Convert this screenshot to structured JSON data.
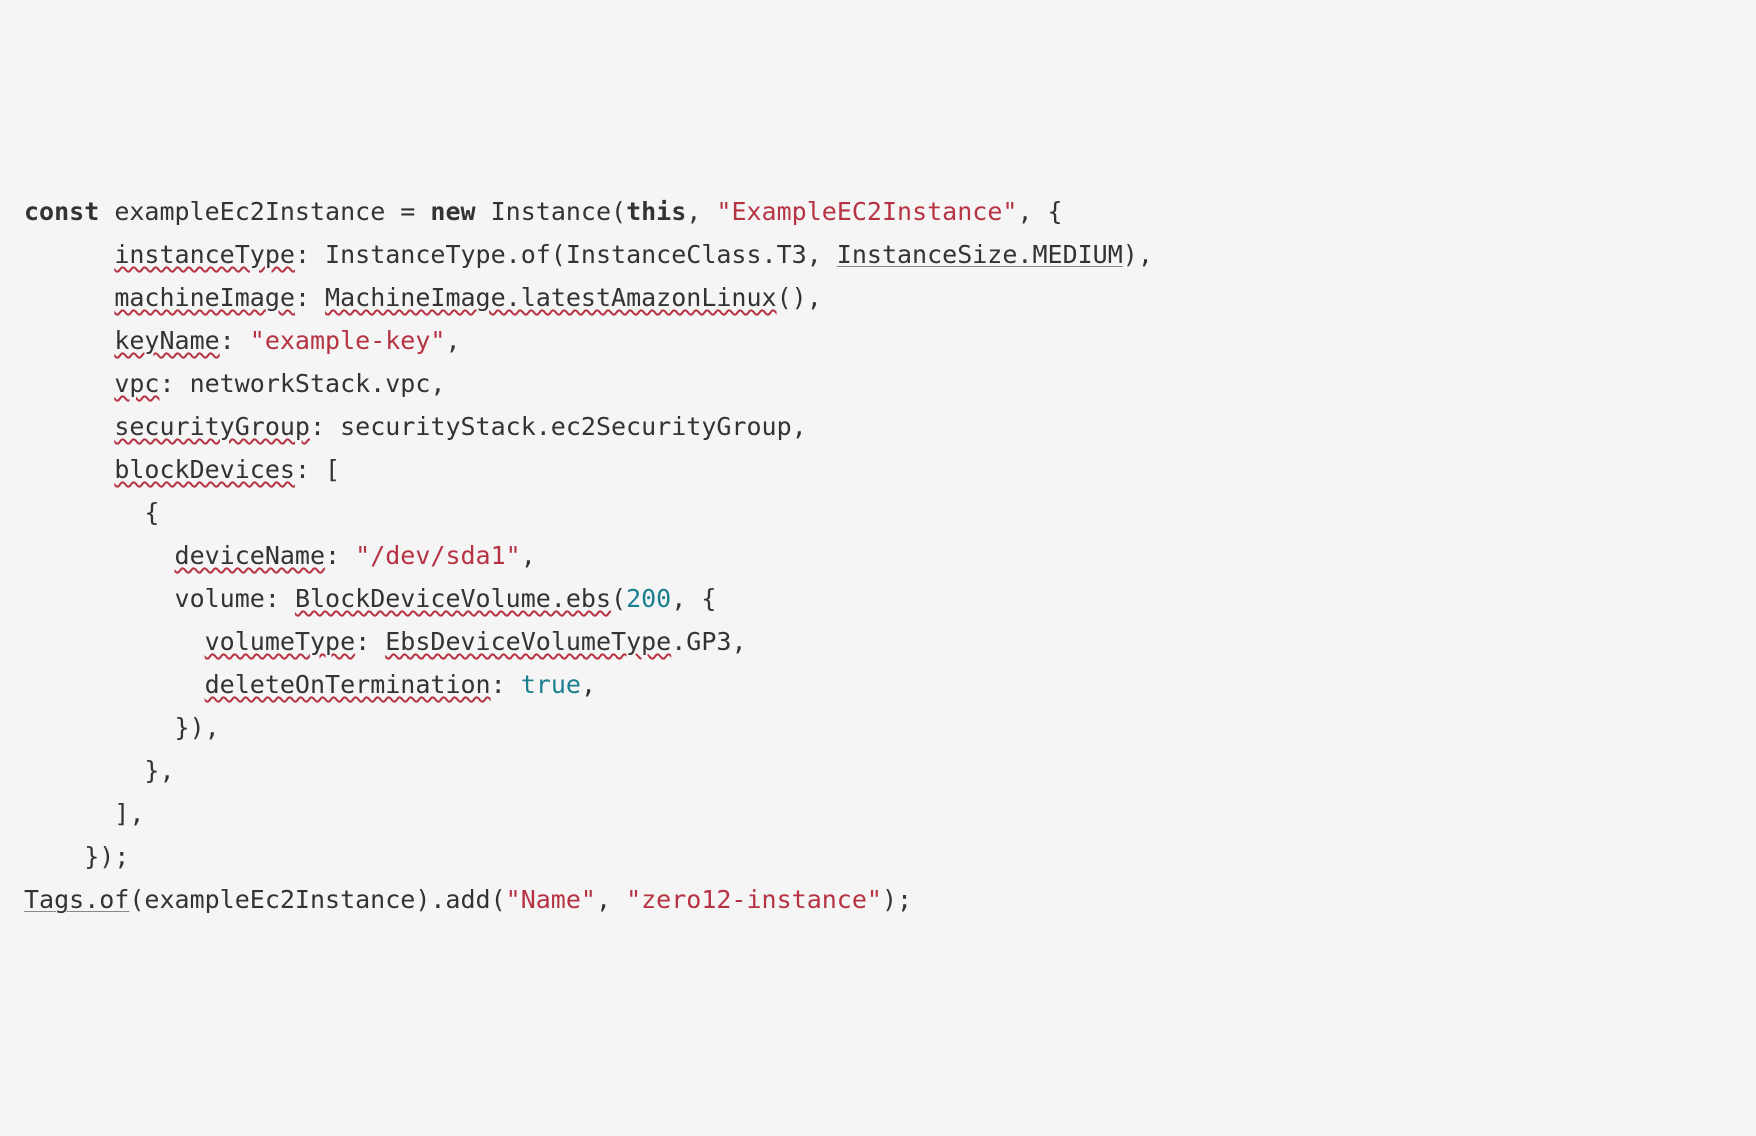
{
  "code": {
    "l1": {
      "t1": "const",
      "t2": " exampleEc2Instance = ",
      "t3": "new",
      "t4": " Instance(",
      "t5": "this",
      "t6": ", ",
      "t7": "\"ExampleEC2Instance\"",
      "t8": ", {"
    },
    "l2": {
      "t1": "      ",
      "t2": "instanceType",
      "t3": ": InstanceType.of(InstanceClass.T3, ",
      "t4": "InstanceSize.MEDIUM",
      "t5": "),"
    },
    "l3": {
      "t1": "      ",
      "t2": "machineImage",
      "t3": ": ",
      "t4": "MachineImage.latestAmazonLinux",
      "t5": "(),"
    },
    "l4": {
      "t1": "      ",
      "t2": "keyName",
      "t3": ": ",
      "t4": "\"example-key\"",
      "t5": ","
    },
    "l5": {
      "t1": "      ",
      "t2": "vpc",
      "t3": ": networkStack.vpc,"
    },
    "l6": {
      "t1": "      ",
      "t2": "securityGroup",
      "t3": ": securityStack.ec2SecurityGroup,"
    },
    "l7": {
      "t1": "      ",
      "t2": "blockDevices",
      "t3": ": ["
    },
    "l8": {
      "t1": "        {"
    },
    "l9": {
      "t1": "          ",
      "t2": "deviceName",
      "t3": ": ",
      "t4": "\"/dev/sda1\"",
      "t5": ","
    },
    "l10": {
      "t1": "          volume: ",
      "t2": "BlockDeviceVolume.ebs",
      "t3": "(",
      "t4": "200",
      "t5": ", {"
    },
    "l11": {
      "t1": "            ",
      "t2": "volumeType",
      "t3": ": ",
      "t4": "EbsDeviceVolumeType",
      "t5": ".GP3,"
    },
    "l12": {
      "t1": "            ",
      "t2": "deleteOnTermination",
      "t3": ": ",
      "t4": "true",
      "t5": ","
    },
    "l13": {
      "t1": "          }),"
    },
    "l14": {
      "t1": "        },"
    },
    "l15": {
      "t1": "      ],"
    },
    "l16": {
      "t1": "    });"
    },
    "l17": {
      "t1": "Tags.of",
      "t2": "(exampleEc2Instance).add(",
      "t3": "\"Name\"",
      "t4": ", ",
      "t5": "\"zero12-instance\"",
      "t6": ");"
    }
  }
}
